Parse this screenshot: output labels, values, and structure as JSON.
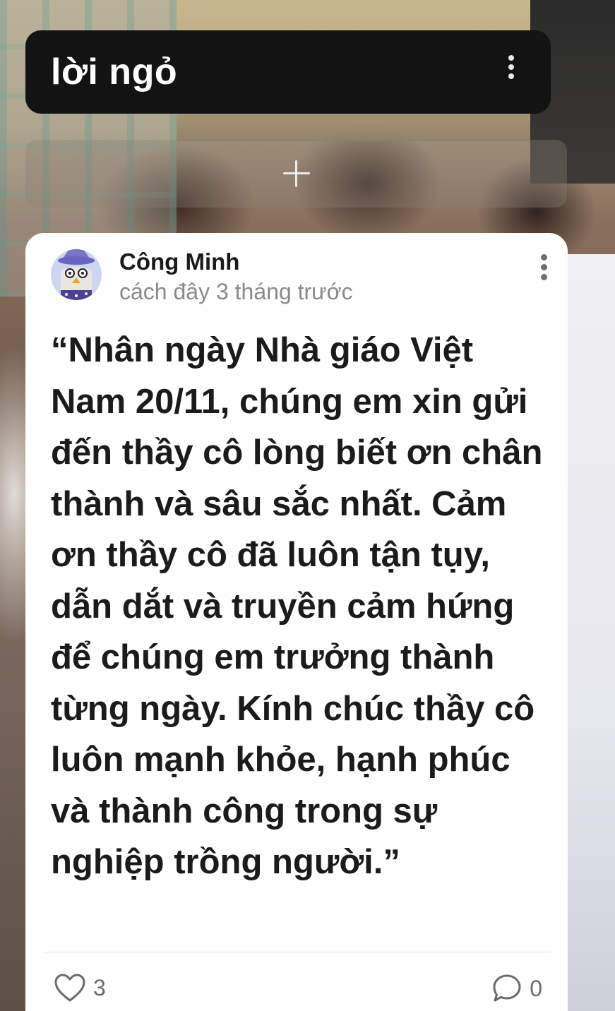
{
  "header": {
    "title": "lời ngỏ",
    "menu_icon": "more-vertical-icon"
  },
  "add_bar": {
    "icon": "plus-icon"
  },
  "post": {
    "author": "Công Minh",
    "timestamp": "cách đây 3 tháng trước",
    "menu_icon": "more-vertical-icon",
    "content": "“Nhân ngày Nhà giáo Việt Nam 20/11, chúng em xin gửi đến thầy cô lòng biết ơn chân thành và sâu sắc nhất. Cảm ơn thầy cô đã luôn tận tụy, dẫn dắt và truyền cảm hứng để chúng em trưởng thành từng ngày. Kính chúc thầy cô luôn mạnh khỏe, hạnh phúc và thành công trong sự nghiệp trồng người.”",
    "likes": "3",
    "comments": "0",
    "like_icon": "heart-icon",
    "comment_icon": "comment-icon"
  },
  "colors": {
    "header_bg": "#131313",
    "card_bg": "#ffffff",
    "text": "#1b1b1b",
    "muted": "#8a8a8a"
  }
}
